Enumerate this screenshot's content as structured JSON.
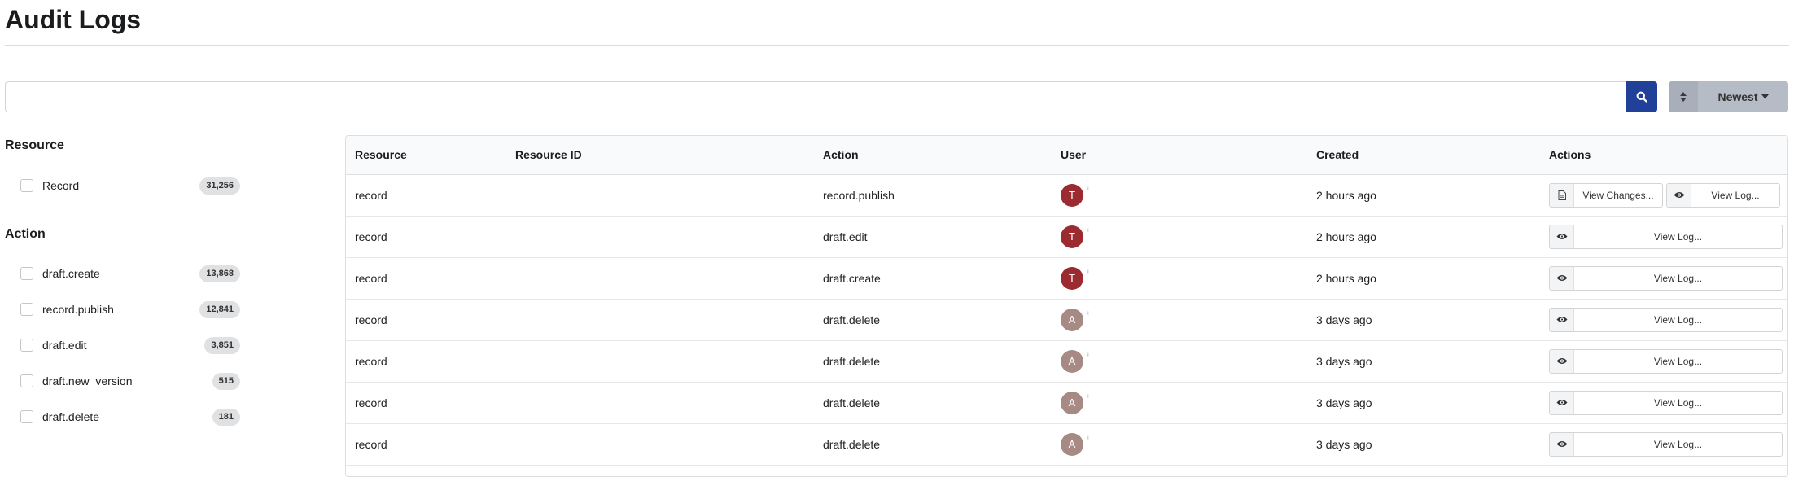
{
  "page": {
    "title": "Audit Logs"
  },
  "search": {
    "placeholder": "",
    "value": ""
  },
  "sort": {
    "selected": "Newest"
  },
  "facets": {
    "resource": {
      "heading": "Resource",
      "items": [
        {
          "label": "Record",
          "count": "31,256"
        }
      ]
    },
    "action": {
      "heading": "Action",
      "items": [
        {
          "label": "draft.create",
          "count": "13,868"
        },
        {
          "label": "record.publish",
          "count": "12,841"
        },
        {
          "label": "draft.edit",
          "count": "3,851"
        },
        {
          "label": "draft.new_version",
          "count": "515"
        },
        {
          "label": "draft.delete",
          "count": "181"
        }
      ]
    }
  },
  "table": {
    "columns": [
      "Resource",
      "Resource ID",
      "Action",
      "User",
      "Created",
      "Actions"
    ],
    "rows": [
      {
        "resource": "record",
        "resource_id": "",
        "action": "record.publish",
        "user_initial": "T",
        "created": "2 hours ago",
        "view_changes": "View Changes...",
        "view_log": "View Log..."
      },
      {
        "resource": "record",
        "resource_id": "",
        "action": "draft.edit",
        "user_initial": "T",
        "created": "2 hours ago",
        "view_log": "View Log..."
      },
      {
        "resource": "record",
        "resource_id": "",
        "action": "draft.create",
        "user_initial": "T",
        "created": "2 hours ago",
        "view_log": "View Log..."
      },
      {
        "resource": "record",
        "resource_id": "",
        "action": "draft.delete",
        "user_initial": "A",
        "created": "3 days ago",
        "view_log": "View Log..."
      },
      {
        "resource": "record",
        "resource_id": "",
        "action": "draft.delete",
        "user_initial": "A",
        "created": "3 days ago",
        "view_log": "View Log..."
      },
      {
        "resource": "record",
        "resource_id": "",
        "action": "draft.delete",
        "user_initial": "A",
        "created": "3 days ago",
        "view_log": "View Log..."
      },
      {
        "resource": "record",
        "resource_id": "",
        "action": "draft.delete",
        "user_initial": "A",
        "created": "3 days ago",
        "view_log": "View Log..."
      }
    ]
  },
  "colors": {
    "primary": "#21409a",
    "avatar_t": "#9b2b31",
    "avatar_a": "#a68a83"
  },
  "icons": {
    "search": "search-icon",
    "sort": "sort-icon",
    "view_changes": "file-icon",
    "view_log": "eye-icon"
  }
}
